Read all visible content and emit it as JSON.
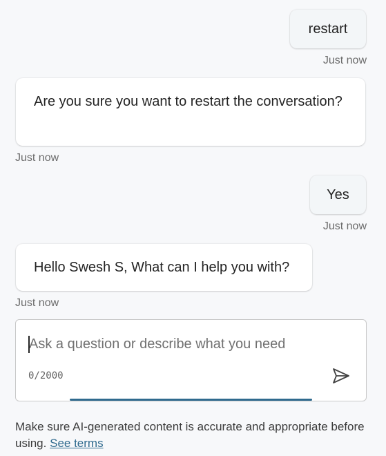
{
  "messages": [
    {
      "role": "user",
      "text": "restart",
      "timestamp": "Just now"
    },
    {
      "role": "assistant",
      "text": "Are you sure you want to restart the conversation?",
      "timestamp": "Just now"
    },
    {
      "role": "user",
      "text": "Yes",
      "timestamp": "Just now"
    },
    {
      "role": "assistant",
      "text": "Hello Swesh S, What can I help you with?",
      "timestamp": "Just now"
    }
  ],
  "composer": {
    "placeholder": "Ask a question or describe what you need",
    "counter": "0/2000",
    "send_icon": "send-icon"
  },
  "disclaimer": {
    "text": "Make sure AI-generated content is accurate and appropriate before using.",
    "link": "See terms"
  },
  "colors": {
    "background": "#f7f8fa",
    "accent": "#2f6a8e",
    "user_bubble": "#f3f6f8",
    "assistant_bubble": "#ffffff"
  }
}
